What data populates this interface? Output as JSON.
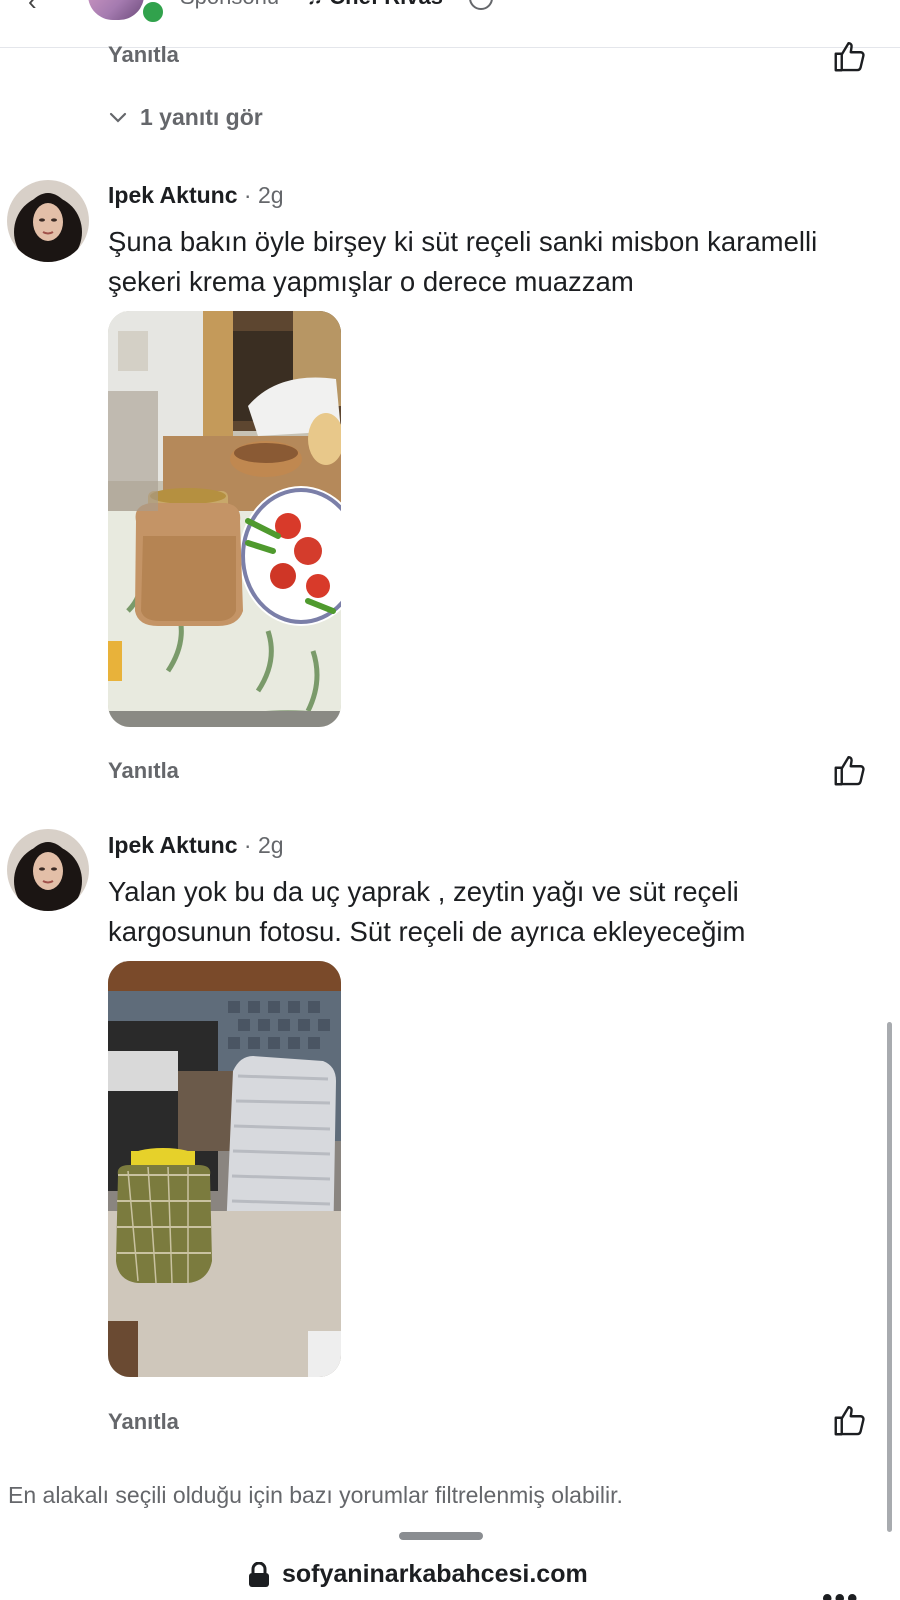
{
  "header": {
    "back_glyph": "‹",
    "sponsored_label": "Sponsorlu",
    "separator": "·",
    "music_note": "♫",
    "artist": "Chef Rivas",
    "privacy_icon": "globe-icon"
  },
  "previous_comment": {
    "reply_label": "Yanıtla",
    "view_replies_label": "1 yanıtı gör"
  },
  "comments": [
    {
      "author": "Ipek Aktunc",
      "time": "· 2g",
      "text": "Şuna bakın öyle birşey ki süt reçeli sanki misbon karamelli şekeri krema yapmışlar o derece muazzam",
      "reply_label": "Yanıtla",
      "photo": "photo-jar-breakfast"
    },
    {
      "author": "Ipek Aktunc",
      "time": "· 2g",
      "text": "Yalan yok bu da uç yaprak , zeytin yağı ve süt reçeli kargosunun fotosu. Süt reçeli de ayrıca ekleyeceğim",
      "reply_label": "Yanıtla",
      "photo": "photo-package-kitchen"
    }
  ],
  "footer": {
    "filter_note": "En alakalı seçili olduğu için bazı yorumlar filtrelenmiş olabilir.",
    "url": "sofyaninarkabahcesi.com",
    "more_label": "•••"
  },
  "colors": {
    "text_primary": "#1c1e21",
    "text_secondary": "#65676b",
    "online_dot": "#31a24c",
    "divider": "#e4e6eb"
  }
}
